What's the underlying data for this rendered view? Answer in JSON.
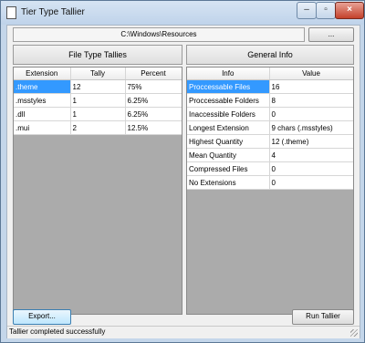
{
  "window": {
    "title": "Tier Type Tallier",
    "controls": {
      "minimize": "–",
      "maximize": "▫",
      "close": "×"
    }
  },
  "path": {
    "value": "C:\\Windows\\Resources",
    "browse_label": "..."
  },
  "file_tallies": {
    "header": "File Type Tallies",
    "columns": [
      "Extension",
      "Tally",
      "Percent"
    ],
    "rows": [
      {
        "extension": ".theme",
        "tally": "12",
        "percent": "75%"
      },
      {
        "extension": ".msstyles",
        "tally": "1",
        "percent": "6.25%"
      },
      {
        "extension": ".dll",
        "tally": "1",
        "percent": "6.25%"
      },
      {
        "extension": ".mui",
        "tally": "2",
        "percent": "12.5%"
      }
    ]
  },
  "general_info": {
    "header": "General Info",
    "columns": [
      "Info",
      "Value"
    ],
    "rows": [
      {
        "info": "Proccessable Files",
        "value": "16"
      },
      {
        "info": "Proccessable Folders",
        "value": "8"
      },
      {
        "info": "Inaccessible Folders",
        "value": "0"
      },
      {
        "info": "Longest Extension",
        "value": "9 chars (.msstyles)"
      },
      {
        "info": "Highest Quantity",
        "value": "12 (.theme)"
      },
      {
        "info": "Mean Quantity",
        "value": "4"
      },
      {
        "info": "Compressed Files",
        "value": "0"
      },
      {
        "info": "No Extensions",
        "value": "0"
      }
    ]
  },
  "buttons": {
    "export": "Export...",
    "run": "Run Tallier"
  },
  "status": "Tallier completed successfully",
  "colors": {
    "selection": "#3399ff",
    "grid_empty": "#ababab"
  }
}
